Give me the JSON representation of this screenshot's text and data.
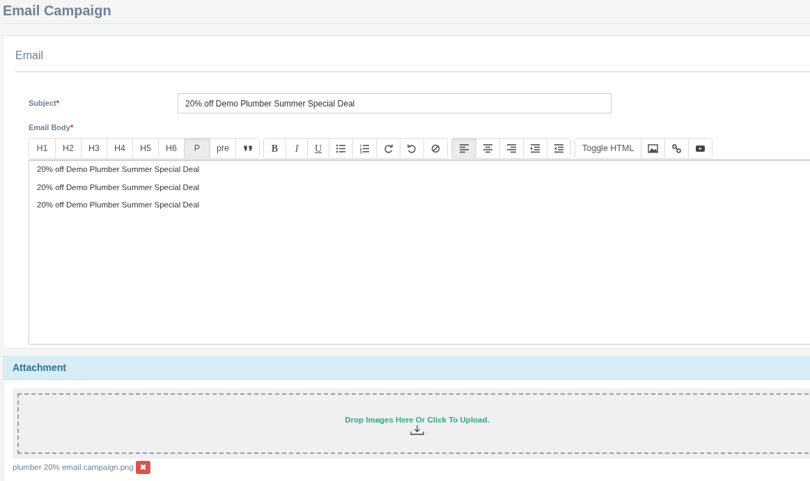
{
  "page_title": "Email Campaign",
  "email_panel": {
    "title": "Email",
    "subject_label": "Subject",
    "subject_required": "*",
    "subject_value": "20% off Demo Plumber Summer Special Deal",
    "body_label": "Email Body",
    "body_required": "*",
    "toolbar": [
      [
        {
          "kind": "text",
          "label": "H1",
          "selected": false
        },
        {
          "kind": "text",
          "label": "H2",
          "selected": false
        },
        {
          "kind": "text",
          "label": "H3",
          "selected": false
        },
        {
          "kind": "text",
          "label": "H4",
          "selected": false
        },
        {
          "kind": "text",
          "label": "H5",
          "selected": false
        },
        {
          "kind": "text",
          "label": "H6",
          "selected": false
        },
        {
          "kind": "text",
          "label": "P",
          "selected": true
        },
        {
          "kind": "text",
          "label": "pre",
          "selected": false
        },
        {
          "kind": "quote",
          "selected": false
        }
      ],
      [
        {
          "kind": "bold",
          "label": "B",
          "selected": false
        },
        {
          "kind": "italic",
          "label": "I",
          "selected": false
        },
        {
          "kind": "underline",
          "label": "U",
          "selected": false
        },
        {
          "kind": "bullets",
          "selected": false
        },
        {
          "kind": "numbers",
          "selected": false
        },
        {
          "kind": "redo",
          "selected": false
        },
        {
          "kind": "undo",
          "selected": false
        },
        {
          "kind": "clear",
          "selected": false
        }
      ],
      [
        {
          "kind": "align-left",
          "selected": true
        },
        {
          "kind": "align-center",
          "selected": false
        },
        {
          "kind": "align-right",
          "selected": false
        },
        {
          "kind": "indent",
          "selected": false
        },
        {
          "kind": "outdent",
          "selected": false
        }
      ],
      [
        {
          "kind": "text",
          "label": "Toggle HTML",
          "selected": false
        },
        {
          "kind": "image",
          "selected": false
        },
        {
          "kind": "link",
          "selected": false
        },
        {
          "kind": "video",
          "selected": false
        }
      ]
    ],
    "body_paragraphs": [
      "20% off Demo Plumber Summer Special Deal",
      "20% off Demo Plumber Summer Special Deal",
      "20% off Demo Plumber Summer Special Deal"
    ]
  },
  "attachment_panel": {
    "title": "Attachment",
    "dropzone_text": "Drop Images Here Or Click To Upload.",
    "files": [
      {
        "name": "plumber 20% email campaign.png",
        "remove_label": "✖"
      }
    ]
  }
}
